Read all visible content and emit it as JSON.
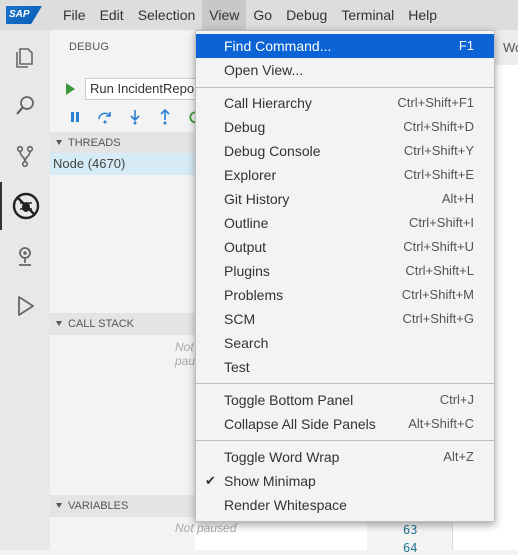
{
  "menubar": {
    "logo_text": "SAP",
    "items": [
      "File",
      "Edit",
      "Selection",
      "View",
      "Go",
      "Debug",
      "Terminal",
      "Help"
    ],
    "active": "View"
  },
  "activity_bar": {
    "icons": [
      "explorer-icon",
      "search-icon",
      "git-icon",
      "debug-icon",
      "extensions-icon",
      "run-icon"
    ]
  },
  "sidebar": {
    "title": "DEBUG",
    "run_config": "Run IncidentReporter",
    "sections": {
      "threads": "THREADS",
      "call_stack": "CALL STACK",
      "variables": "VARIABLES"
    },
    "thread_item": "Node (4670)",
    "call_stack_placeholder": "Not paused",
    "variables_placeholder": "Not paused"
  },
  "editor": {
    "tab_partial": "Wo",
    "line_numbers": [
      "63",
      "64"
    ]
  },
  "view_menu": {
    "groups": [
      [
        {
          "label": "Find Command...",
          "key": "F1",
          "highlighted": true
        },
        {
          "label": "Open View...",
          "key": ""
        }
      ],
      [
        {
          "label": "Call Hierarchy",
          "key": "Ctrl+Shift+F1"
        },
        {
          "label": "Debug",
          "key": "Ctrl+Shift+D"
        },
        {
          "label": "Debug Console",
          "key": "Ctrl+Shift+Y"
        },
        {
          "label": "Explorer",
          "key": "Ctrl+Shift+E"
        },
        {
          "label": "Git History",
          "key": "Alt+H"
        },
        {
          "label": "Outline",
          "key": "Ctrl+Shift+I"
        },
        {
          "label": "Output",
          "key": "Ctrl+Shift+U"
        },
        {
          "label": "Plugins",
          "key": "Ctrl+Shift+L"
        },
        {
          "label": "Problems",
          "key": "Ctrl+Shift+M"
        },
        {
          "label": "SCM",
          "key": "Ctrl+Shift+G"
        },
        {
          "label": "Search",
          "key": ""
        },
        {
          "label": "Test",
          "key": ""
        }
      ],
      [
        {
          "label": "Toggle Bottom Panel",
          "key": "Ctrl+J"
        },
        {
          "label": "Collapse All Side Panels",
          "key": "Alt+Shift+C"
        }
      ],
      [
        {
          "label": "Toggle Word Wrap",
          "key": "Alt+Z"
        },
        {
          "label": "Show Minimap",
          "key": "",
          "checked": true
        },
        {
          "label": "Render Whitespace",
          "key": ""
        }
      ]
    ]
  },
  "colors": {
    "highlight": "#0b63d6",
    "run_green": "#3a9a3a",
    "toolbar_blue": "#2a7fd4",
    "thread_selected": "#d6ebf6"
  }
}
